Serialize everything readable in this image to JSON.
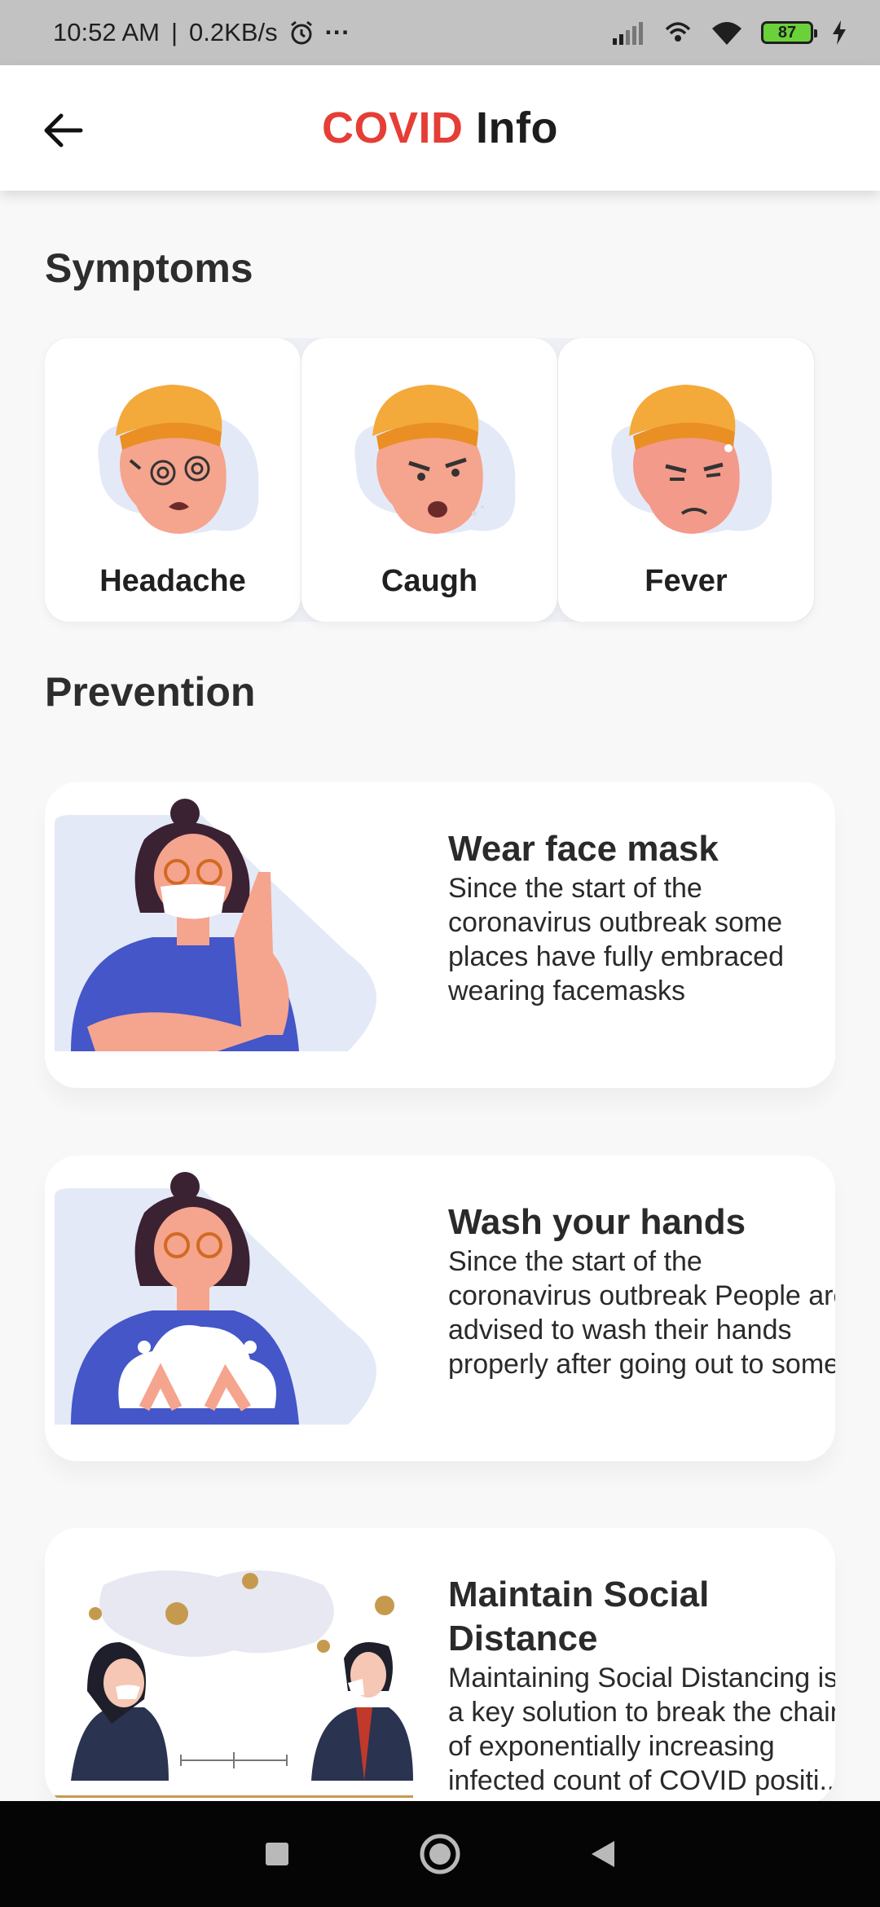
{
  "status_bar": {
    "time": "10:52 AM",
    "speed": "0.2KB/s",
    "more": "···",
    "battery": "87"
  },
  "app_bar": {
    "title_accent": "COVID",
    "title_rest": "Info",
    "accent_color": "#e53e36"
  },
  "symptoms": {
    "heading": "Symptoms",
    "items": [
      {
        "label": "Headache",
        "icon": "headache-face-icon"
      },
      {
        "label": "Caugh",
        "icon": "cough-face-icon"
      },
      {
        "label": "Fever",
        "icon": "fever-face-icon"
      }
    ]
  },
  "prevention": {
    "heading": "Prevention",
    "items": [
      {
        "title": "Wear face mask",
        "desc": [
          "Since the start of the",
          "coronavirus outbreak some",
          "places have fully embraced",
          "wearing facemasks"
        ]
      },
      {
        "title": "Wash your hands",
        "desc": [
          "Since the start of the",
          "coronavirus outbreak People are",
          "advised to wash their hands",
          "properly after going out to some"
        ]
      },
      {
        "title_lines": [
          "Maintain Social",
          "Distance"
        ],
        "desc": [
          "Maintaining Social Distancing is",
          "a key solution to break the chain",
          "of exponentially increasing",
          "infected count of COVID positi..."
        ]
      }
    ]
  },
  "colors": {
    "hat": "#f4a93b",
    "skin": "#f5a48e",
    "shirt": "#4456c8",
    "blob": "#e4e9f7"
  }
}
